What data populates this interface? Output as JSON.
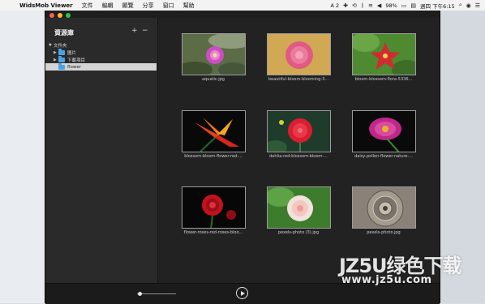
{
  "menubar": {
    "apple_glyph": "",
    "items": [
      "WidsMob Viewer",
      "文件",
      "編輯",
      "顯覽",
      "分享",
      "窗口",
      "幫助"
    ],
    "status": {
      "input": "A 2",
      "battery": "98%",
      "datetime": "週四 下午6:15"
    }
  },
  "sidebar": {
    "title": "資源庫",
    "add_label": "+",
    "remove_label": "−",
    "tree": [
      {
        "label": "文件夾",
        "chevron": "▼"
      },
      {
        "label": "圖片",
        "chevron": "▶"
      },
      {
        "label": "下載項目",
        "chevron": "▶"
      },
      {
        "label": "flower",
        "chevron": ""
      }
    ]
  },
  "gallery": {
    "items": [
      {
        "caption": "aquatic.jpg"
      },
      {
        "caption": "beautiful-bloom-blooming-3..."
      },
      {
        "caption": "bloom-blossom-flora-5336..."
      },
      {
        "caption": "blossom-bloom-flower-red-..."
      },
      {
        "caption": "dahlia-red-blossom-bloom-..."
      },
      {
        "caption": "daisy-pollen-flower-nature-..."
      },
      {
        "caption": "flower-roses-red-roses-bloo..."
      },
      {
        "caption": "pexels-photo (3).jpg"
      },
      {
        "caption": "pexels-photo.jpg"
      }
    ]
  },
  "bottombar": {
    "zoom_slider_value": 0.05
  },
  "watermark": {
    "brand": "JZ5U绿色下载",
    "url": "www.jz5u.com"
  }
}
